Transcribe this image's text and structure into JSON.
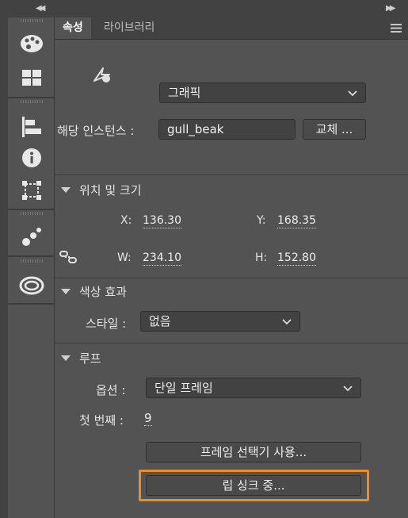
{
  "tabs": [
    "속성",
    "라이브러리"
  ],
  "symbol": {
    "type": "그래픽",
    "instance_label": "해당 인스턴스 :",
    "instance_name": "gull_beak",
    "swap_button": "교체 ..."
  },
  "position_size": {
    "header": "위치 및 크기",
    "x_label": "X:",
    "x": "136.30",
    "y_label": "Y:",
    "y": "168.35",
    "w_label": "W:",
    "w": "234.10",
    "h_label": "H:",
    "h": "152.80"
  },
  "color_effect": {
    "header": "색상 효과",
    "style_label": "스타일 :",
    "style_value": "없음"
  },
  "loop": {
    "header": "루프",
    "options_label": "옵션 :",
    "options_value": "단일 프레임",
    "first_label": "첫 번째 :",
    "first_value": "9",
    "frame_picker_button": "프레임 선택기 사용...",
    "lip_sync_button": "립 싱크 중..."
  },
  "highlight_color": "#f08c22",
  "icons": [
    "collapse-left-icon",
    "collapse-right-icon",
    "palette-icon",
    "swatches-icon",
    "align-icon",
    "info-icon",
    "transform-icon",
    "motion-presets-icon",
    "cc-libraries-icon",
    "graphic-symbol-icon",
    "link-icon",
    "panel-menu-icon"
  ]
}
